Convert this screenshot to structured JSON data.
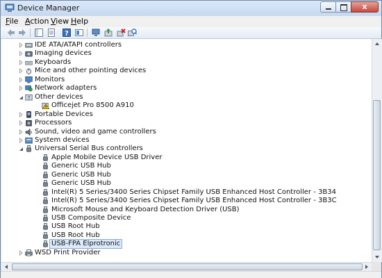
{
  "window": {
    "title": "Device Manager",
    "close_label": "x"
  },
  "menu": [
    {
      "label": "File",
      "key": "F",
      "rest": "ile"
    },
    {
      "label": "Action",
      "key": "A",
      "rest": "ction"
    },
    {
      "label": "View",
      "key": "V",
      "rest": "iew"
    },
    {
      "label": "Help",
      "key": "H",
      "rest": "elp"
    }
  ],
  "toolbar_icons": [
    "back-icon",
    "forward-icon",
    "show-hide-tree-icon",
    "properties-icon",
    "help-icon",
    "view-resources-icon",
    "update-driver-icon",
    "uninstall-icon",
    "scan-hardware-icon"
  ],
  "tree": [
    {
      "label": "IDE ATA/ATAPI controllers",
      "icon": "ide-controller-icon",
      "level": 0,
      "expander": "collapsed"
    },
    {
      "label": "Imaging devices",
      "icon": "imaging-icon",
      "level": 0,
      "expander": "collapsed"
    },
    {
      "label": "Keyboards",
      "icon": "keyboard-icon",
      "level": 0,
      "expander": "collapsed"
    },
    {
      "label": "Mice and other pointing devices",
      "icon": "mouse-icon",
      "level": 0,
      "expander": "collapsed"
    },
    {
      "label": "Monitors",
      "icon": "monitor-icon",
      "level": 0,
      "expander": "collapsed"
    },
    {
      "label": "Network adapters",
      "icon": "network-icon",
      "level": 0,
      "expander": "collapsed"
    },
    {
      "label": "Other devices",
      "icon": "other-devices-icon",
      "level": 0,
      "expander": "expanded"
    },
    {
      "label": "Officejet Pro 8500 A910",
      "icon": "warning-device-icon",
      "level": 1
    },
    {
      "label": "Portable Devices",
      "icon": "portable-device-icon",
      "level": 0,
      "expander": "collapsed"
    },
    {
      "label": "Processors",
      "icon": "processor-icon",
      "level": 0,
      "expander": "collapsed"
    },
    {
      "label": "Sound, video and game controllers",
      "icon": "sound-icon",
      "level": 0,
      "expander": "collapsed"
    },
    {
      "label": "System devices",
      "icon": "system-icon",
      "level": 0,
      "expander": "collapsed"
    },
    {
      "label": "Universal Serial Bus controllers",
      "icon": "usb-icon",
      "level": 0,
      "expander": "expanded"
    },
    {
      "label": "Apple Mobile Device USB Driver",
      "icon": "usb-icon",
      "level": 1
    },
    {
      "label": "Generic USB Hub",
      "icon": "usb-icon",
      "level": 1
    },
    {
      "label": "Generic USB Hub",
      "icon": "usb-icon",
      "level": 1
    },
    {
      "label": "Generic USB Hub",
      "icon": "usb-icon",
      "level": 1
    },
    {
      "label": "Intel(R) 5 Series/3400 Series Chipset Family USB Enhanced Host Controller - 3B34",
      "icon": "usb-icon",
      "level": 1
    },
    {
      "label": "Intel(R) 5 Series/3400 Series Chipset Family USB Enhanced Host Controller - 3B3C",
      "icon": "usb-icon",
      "level": 1
    },
    {
      "label": "Microsoft Mouse and Keyboard Detection Driver (USB)",
      "icon": "usb-icon",
      "level": 1
    },
    {
      "label": "USB Composite Device",
      "icon": "usb-icon",
      "level": 1
    },
    {
      "label": "USB Root Hub",
      "icon": "usb-icon",
      "level": 1
    },
    {
      "label": "USB Root Hub",
      "icon": "usb-icon",
      "level": 1
    },
    {
      "label": "USB-FPA Elprotronic",
      "icon": "usb-icon",
      "level": 1,
      "selected": true
    },
    {
      "label": "WSD Print Provider",
      "icon": "printer-icon",
      "level": 0,
      "expander": "collapsed"
    }
  ]
}
